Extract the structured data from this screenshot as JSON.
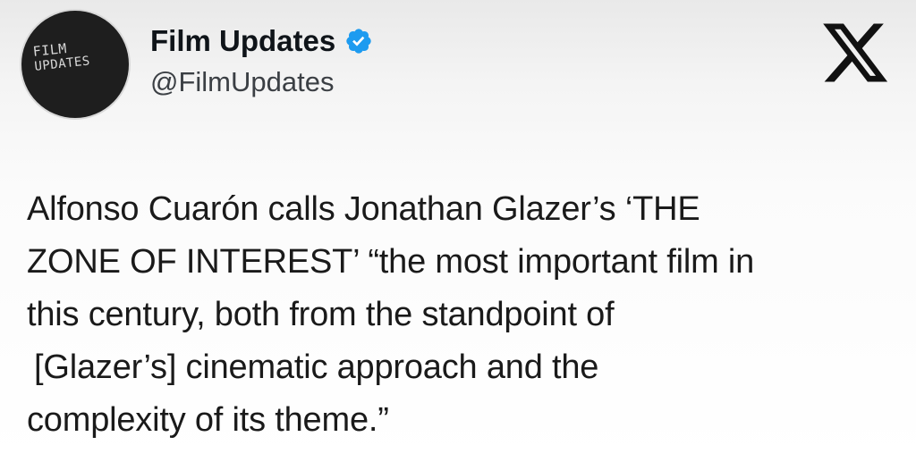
{
  "author": {
    "avatar": {
      "line1": "FILM",
      "line2": "UPDATES",
      "background": "#1e1e1e"
    },
    "display_name": "Film Updates",
    "handle": "@FilmUpdates",
    "verified": true,
    "verified_color": "#1d9bf0"
  },
  "platform": {
    "logo_icon": "x-logo-icon"
  },
  "tweet": {
    "lines": [
      "Alfonso Cuarón calls Jonathan Glazer’s ‘THE",
      "ZONE OF INTEREST’ “the most important film in",
      "this century, both from the standpoint of",
      "[Glazer’s] cinematic approach and the",
      "complexity of its theme.”"
    ]
  }
}
